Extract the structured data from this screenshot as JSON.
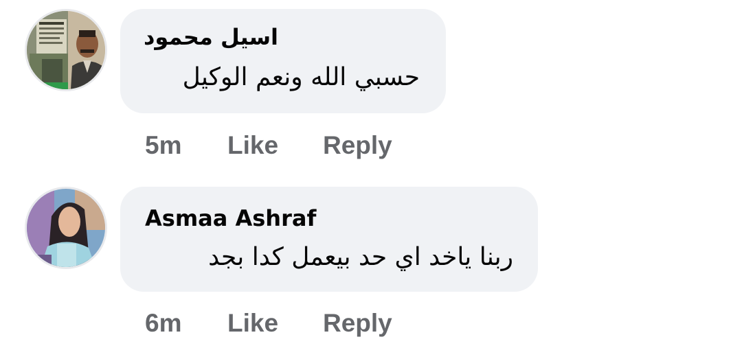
{
  "comments": [
    {
      "author": "اسيل محمود",
      "text": "حسبي الله ونعم الوكيل",
      "time": "5m",
      "like_label": "Like",
      "reply_label": "Reply",
      "avatar_icon": "user-avatar-photo"
    },
    {
      "author": "Asmaa Ashraf",
      "text": "ربنا ياخد اي حد بيعمل كدا بجد",
      "time": "6m",
      "like_label": "Like",
      "reply_label": "Reply",
      "avatar_icon": "user-avatar-photo"
    }
  ],
  "colors": {
    "bubble_bg": "#f0f2f5",
    "name_text": "#050505",
    "action_text": "#65676b"
  }
}
